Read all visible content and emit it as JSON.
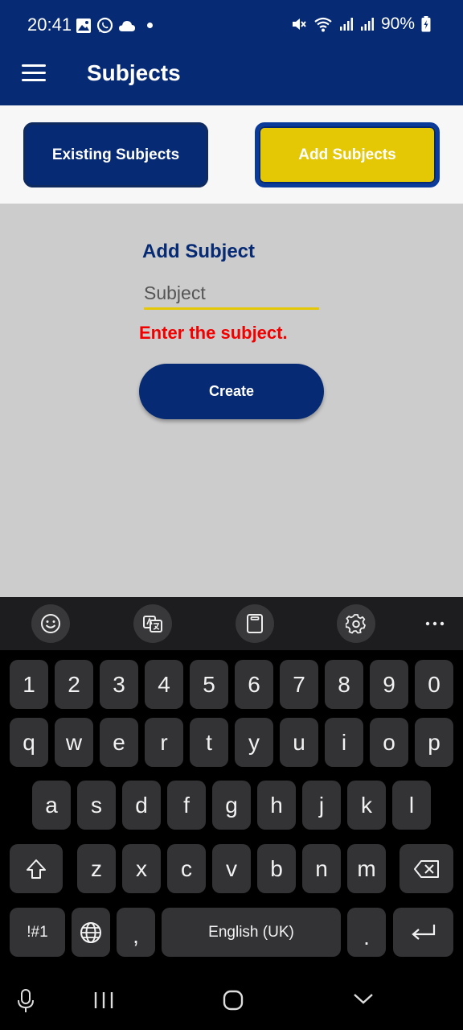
{
  "status": {
    "time": "20:41",
    "battery": "90%"
  },
  "app_bar": {
    "title": "Subjects"
  },
  "tabs": {
    "existing": "Existing Subjects",
    "add": "Add Subjects"
  },
  "form": {
    "heading": "Add Subject",
    "placeholder": "Subject",
    "value": "",
    "error": "Enter the subject.",
    "create_label": "Create"
  },
  "keyboard": {
    "row1": [
      "1",
      "2",
      "3",
      "4",
      "5",
      "6",
      "7",
      "8",
      "9",
      "0"
    ],
    "row2": [
      "q",
      "w",
      "e",
      "r",
      "t",
      "y",
      "u",
      "i",
      "o",
      "p"
    ],
    "row3": [
      "a",
      "s",
      "d",
      "f",
      "g",
      "h",
      "j",
      "k",
      "l"
    ],
    "row4": [
      "z",
      "x",
      "c",
      "v",
      "b",
      "n",
      "m"
    ],
    "symbols": "!#1",
    "comma": ",",
    "space": "English (UK)",
    "period": "."
  },
  "colors": {
    "primary": "#062a73",
    "accent": "#e4c705",
    "error": "#f20000",
    "background": "#cccccc"
  }
}
